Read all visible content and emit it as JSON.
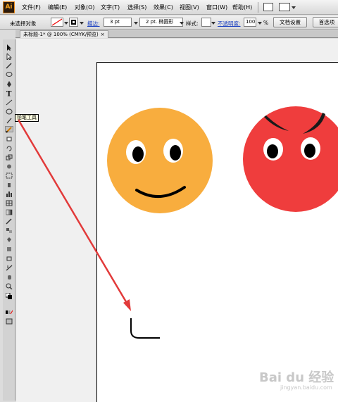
{
  "menubar": {
    "logo": "Ai",
    "items": [
      "文件(F)",
      "编辑(E)",
      "对象(O)",
      "文字(T)",
      "选择(S)",
      "效果(C)",
      "视图(V)",
      "窗口(W)",
      "帮助(H)"
    ]
  },
  "controlbar": {
    "selection_status": "未选择对象",
    "stroke_label": "描边:",
    "stroke_weight": "3 pt",
    "brush": "2 pt. 椭圆形",
    "style_label": "样式:",
    "opacity_label": "不透明度:",
    "opacity_value": "100",
    "opacity_unit": "%",
    "doc_setup_button": "文档设置",
    "prefs_button": "首选项"
  },
  "document_tab": {
    "title": "未标题-1* @ 100% (CMYK/预览)",
    "close": "×"
  },
  "tools": {
    "tooltip": "铅笔工具 (N)",
    "tooltip_visible": "铅笔工具"
  },
  "canvas": {
    "faces": [
      {
        "name": "smiley-face",
        "fill": "#f8ad3e"
      },
      {
        "name": "devil-face",
        "fill": "#ef3d3d"
      }
    ],
    "drawn_stroke_color": "#000000",
    "arrow_color": "#e23a3a"
  },
  "watermark": {
    "main": "Bai du 经验",
    "sub": "jingyan.baidu.com"
  }
}
